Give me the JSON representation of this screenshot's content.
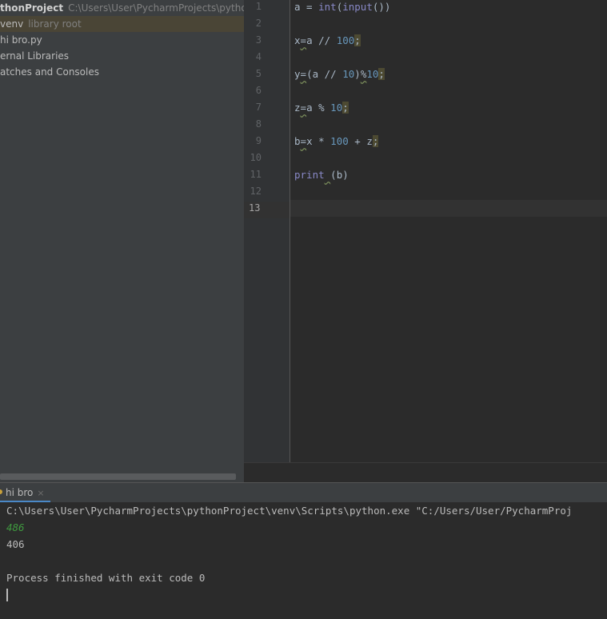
{
  "project_tree": {
    "root": {
      "name": "thonProject",
      "path": "C:\\Users\\User\\PycharmProjects\\pythonProjec"
    },
    "items": [
      {
        "name": "venv",
        "hint": "library root"
      },
      {
        "name": "hi bro.py"
      },
      {
        "name": "ernal Libraries"
      },
      {
        "name": "atches and Consoles"
      }
    ]
  },
  "editor": {
    "line_numbers": [
      "1",
      "2",
      "3",
      "4",
      "5",
      "6",
      "7",
      "8",
      "9",
      "10",
      "11",
      "12",
      "13"
    ],
    "current_line": "13"
  },
  "code": {
    "l1": {
      "a": "a = ",
      "b": "int",
      "c": "(",
      "d": "input",
      "e": "())"
    },
    "l3": {
      "a": "x",
      "b": "=",
      "c": "a // ",
      "d": "100",
      "e": ";"
    },
    "l5": {
      "a": "y",
      "b": "=",
      "c": "(a // ",
      "d": "10",
      ")": ")",
      "f": "%",
      "g": "10",
      "h": ";"
    },
    "l7": {
      "a": "z",
      "b": "=",
      "c": "a % ",
      "d": "10",
      "e": ";"
    },
    "l9": {
      "a": "b",
      "b": "=",
      "c": "x * ",
      "d": "100",
      "e": " + z",
      "f": ";"
    },
    "l11": {
      "a": "print",
      "b": " ",
      "c": "(b)"
    }
  },
  "run": {
    "tab_label": "hi bro",
    "close": "×",
    "output": [
      "C:\\Users\\User\\PycharmProjects\\pythonProject\\venv\\Scripts\\python.exe \"C:/Users/User/PycharmProj",
      "486",
      "406",
      "",
      "Process finished with exit code 0"
    ]
  },
  "colors": {
    "accent": "#4a88c7",
    "keyword": "#8888c6",
    "number": "#6897bb",
    "input_echo": "#3f9a3f"
  }
}
